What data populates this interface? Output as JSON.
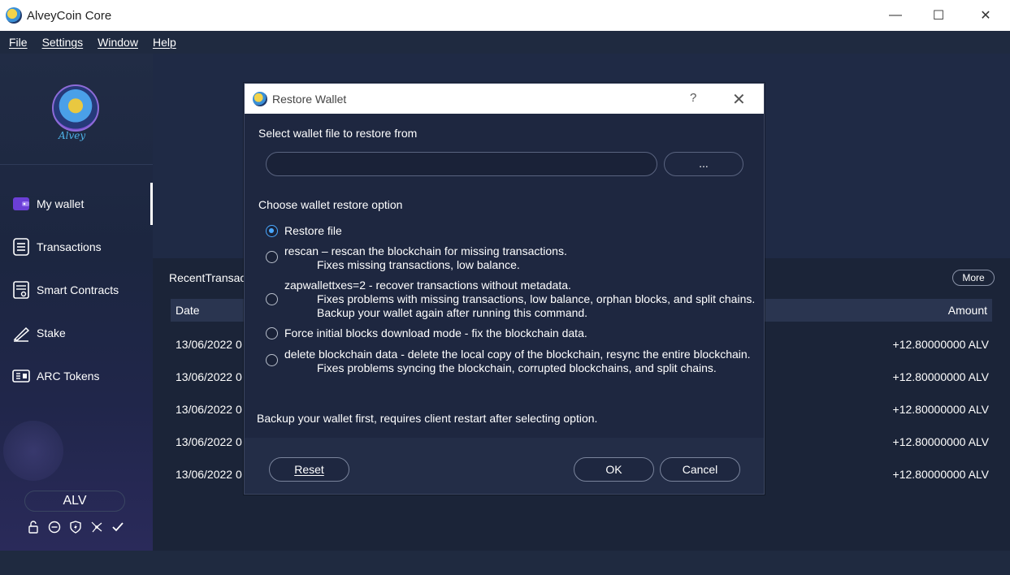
{
  "window": {
    "title": "AlveyCoin Core",
    "minimize": "—",
    "maximize": "☐",
    "close": "✕"
  },
  "menu": [
    "File",
    "Settings",
    "Window",
    "Help"
  ],
  "sidebar": {
    "logo_text": "Alvey",
    "items": [
      {
        "label": "My wallet",
        "icon": "wallet-icon"
      },
      {
        "label": "Transactions",
        "icon": "list-icon"
      },
      {
        "label": "Smart Contracts",
        "icon": "contract-icon"
      },
      {
        "label": "Stake",
        "icon": "stake-icon"
      },
      {
        "label": "ARC Tokens",
        "icon": "tokens-icon"
      }
    ],
    "unit": "ALV",
    "status_icons": [
      "lock-icon",
      "minus-circle-icon",
      "shield-icon",
      "network-icon",
      "check-icon"
    ]
  },
  "main": {
    "recent_title": "RecentTransact",
    "more_label": "More",
    "columns": {
      "date": "Date",
      "amount": "Amount"
    },
    "rows": [
      {
        "date": "13/06/2022 0",
        "amount": "+12.80000000 ALV"
      },
      {
        "date": "13/06/2022 0",
        "amount": "+12.80000000 ALV"
      },
      {
        "date": "13/06/2022 0",
        "amount": "+12.80000000 ALV"
      },
      {
        "date": "13/06/2022 0",
        "amount": "+12.80000000 ALV"
      },
      {
        "date": "13/06/2022 0",
        "amount": "+12.80000000 ALV"
      }
    ]
  },
  "dialog": {
    "title": "Restore Wallet",
    "help": "?",
    "close": "✕",
    "select_label": "Select wallet file to restore from",
    "path_value": "",
    "browse_label": "...",
    "option_label": "Choose wallet restore option",
    "options": [
      {
        "label": "Restore file",
        "subs": [],
        "checked": true
      },
      {
        "label": "rescan – rescan the blockchain for missing transactions.",
        "subs": [
          "Fixes missing transactions, low balance."
        ],
        "checked": false
      },
      {
        "label": "zapwallettxes=2 - recover transactions without metadata.",
        "subs": [
          "Fixes problems with missing transactions, low balance, orphan blocks, and split chains.",
          "Backup your wallet again after running this command."
        ],
        "checked": false
      },
      {
        "label": "Force initial blocks download mode - fix the blockchain data.",
        "subs": [],
        "checked": false
      },
      {
        "label": "delete blockchain data - delete the local copy of the blockchain, resync the entire blockchain.",
        "subs": [
          "Fixes problems syncing the blockchain, corrupted blockchains, and split chains."
        ],
        "checked": false
      }
    ],
    "warning": "Backup your wallet first, requires client restart after selecting option.",
    "reset_label": "Reset",
    "ok_label": "OK",
    "cancel_label": "Cancel"
  },
  "colors": {
    "accent": "#4aa8ff",
    "background": "#1b2438",
    "sidebar": "#212c45"
  }
}
